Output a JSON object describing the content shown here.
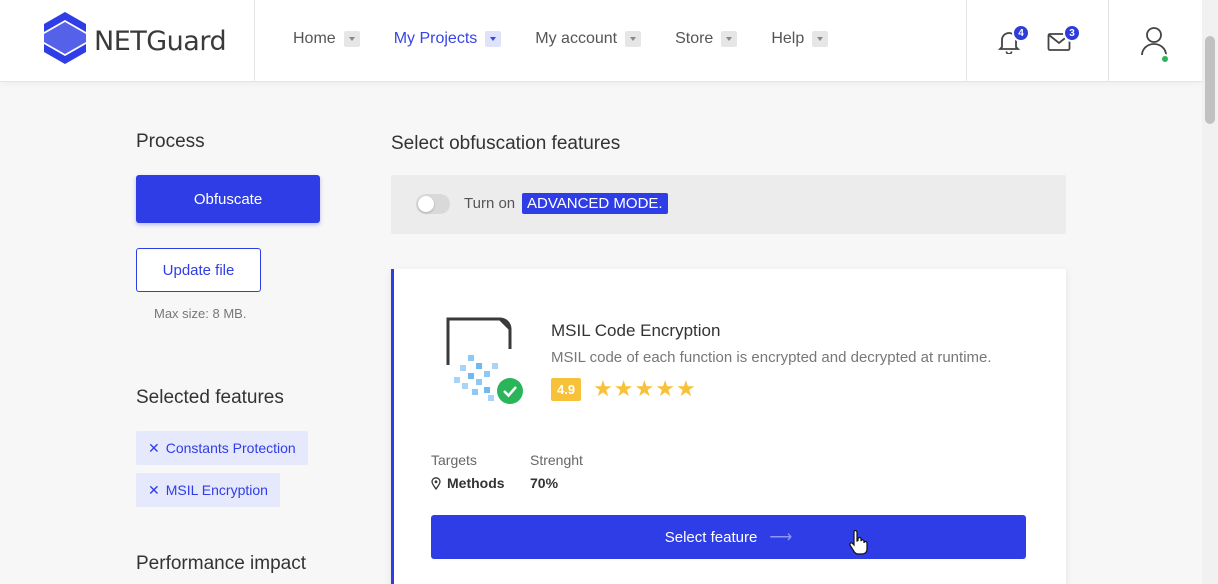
{
  "brand": {
    "name": "NETGuard"
  },
  "nav": [
    {
      "label": "Home"
    },
    {
      "label": "My Projects",
      "active": true
    },
    {
      "label": "My account"
    },
    {
      "label": "Store"
    },
    {
      "label": "Help"
    }
  ],
  "notifications": {
    "bell_count": "4",
    "mail_count": "3"
  },
  "sidebar": {
    "process_title": "Process",
    "obfuscate_label": "Obfuscate",
    "update_label": "Update file",
    "max_size": "Max size: 8 MB.",
    "selected_title": "Selected features",
    "selected": [
      "Constants Protection",
      "MSIL Encryption"
    ],
    "performance_title": "Performance impact"
  },
  "main": {
    "title": "Select obfuscation features",
    "advanced_prefix": "Turn on",
    "advanced_highlight": "ADVANCED MODE.",
    "feature": {
      "name": "MSIL Code Encryption",
      "description": "MSIL code of each function is encrypted and decrypted at runtime.",
      "rating": "4.9",
      "stars": 5,
      "targets_label": "Targets",
      "targets_value": "Methods",
      "strength_label": "Strenght",
      "strength_value": "70%",
      "select_label": "Select feature"
    }
  },
  "colors": {
    "accent": "#2f3de6",
    "star": "#f7c23a",
    "online": "#2bb55a"
  }
}
